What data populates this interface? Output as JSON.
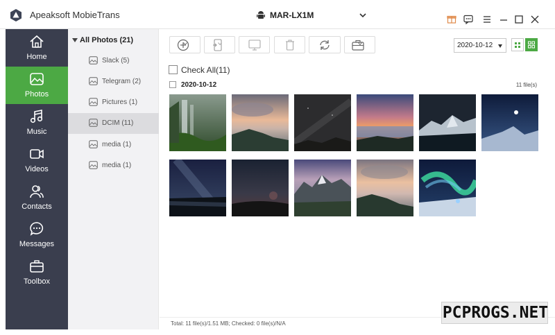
{
  "app": {
    "title": "Apeaksoft MobieTrans"
  },
  "device": {
    "name": "MAR-LX1M"
  },
  "titlebar_icons": [
    "gift-icon",
    "feedback-icon",
    "menu-icon",
    "minimize-icon",
    "maximize-icon",
    "close-icon"
  ],
  "sidebar": {
    "items": [
      {
        "label": "Home",
        "icon": "home-icon"
      },
      {
        "label": "Photos",
        "icon": "photo-icon",
        "active": true
      },
      {
        "label": "Music",
        "icon": "music-icon"
      },
      {
        "label": "Videos",
        "icon": "video-icon"
      },
      {
        "label": "Contacts",
        "icon": "contacts-icon"
      },
      {
        "label": "Messages",
        "icon": "messages-icon"
      },
      {
        "label": "Toolbox",
        "icon": "toolbox-icon"
      }
    ]
  },
  "folders": {
    "root": "All Photos (21)",
    "items": [
      {
        "label": "Slack (5)"
      },
      {
        "label": "Telegram (2)"
      },
      {
        "label": "Pictures (1)"
      },
      {
        "label": "DCIM (11)",
        "selected": true
      },
      {
        "label": "media (1)"
      },
      {
        "label": "media (1)"
      }
    ]
  },
  "toolbar": {
    "buttons": [
      "add-icon",
      "export-to-device-icon",
      "export-to-pc-icon",
      "delete-icon",
      "sync-icon",
      "toolbox-more-icon"
    ],
    "date_filter": "2020-10-12"
  },
  "content": {
    "check_all": "Check All(11)",
    "group_date": "2020-10-12",
    "group_count": "11 file(s)",
    "thumbnail_count": 11
  },
  "status": {
    "text": "Total: 11 file(s)/1.51 MB; Checked: 0 file(s)/N/A"
  },
  "watermark": {
    "text": "PCPROGS.NET"
  },
  "colors": {
    "sidebar": "#3a3e4e",
    "accent": "#4ca944"
  }
}
